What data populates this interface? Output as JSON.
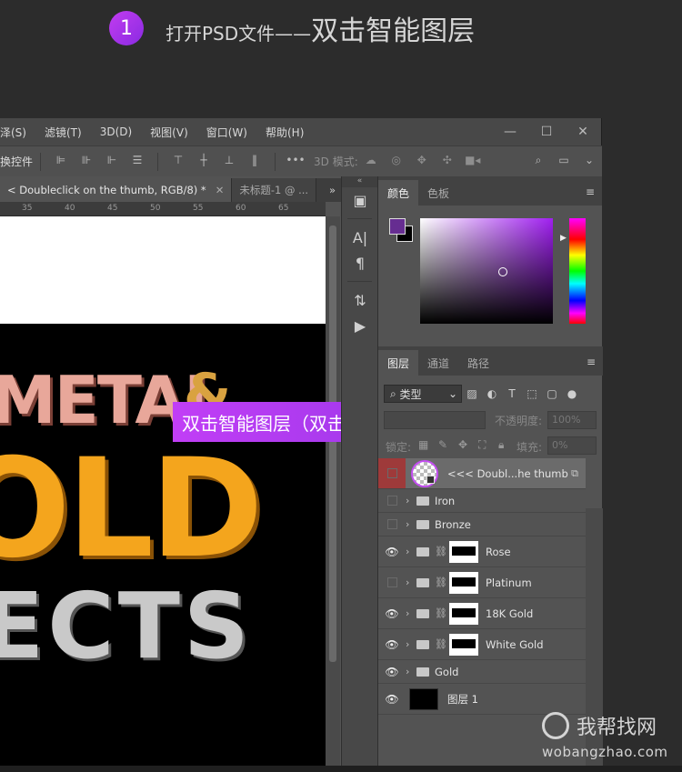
{
  "step": {
    "number": "1",
    "text_prefix": "打开PSD文件——",
    "text_main": "双击智能图层"
  },
  "menubar": {
    "items": [
      "泽(S)",
      "滤镜(T)",
      "3D(D)",
      "视图(V)",
      "窗口(W)",
      "帮助(H)"
    ],
    "window_controls": [
      "—",
      "☐",
      "✕"
    ]
  },
  "optionsbar": {
    "transform_label": "换控件",
    "three_d_mode_label": "3D 模式:"
  },
  "tabs": {
    "active": "< Doubleclick on the thumb, RGB/8) *",
    "inactive": "未标题-1 @ ...",
    "more": "»"
  },
  "ruler": {
    "ticks": [
      "35",
      "40",
      "45",
      "50",
      "55",
      "60",
      "65"
    ]
  },
  "artwork": {
    "line1": "METAL",
    "amp": "&",
    "line2": "OLD",
    "line3": "ECTS"
  },
  "callout": {
    "text": "双击智能图层（双击圈内）"
  },
  "color_panel": {
    "tabs": [
      "颜色",
      "色板"
    ],
    "foreground": "#662d91",
    "background": "#000000"
  },
  "layers_panel": {
    "tabs": [
      "图层",
      "通道",
      "路径"
    ],
    "filter_label": "类型",
    "opacity_label": "不透明度:",
    "opacity_value": "100%",
    "lock_label": "锁定:",
    "fill_label": "填充:",
    "fill_value": "0%",
    "layers": [
      {
        "name": "<<< Doubl...he thumb",
        "visible": false,
        "selected": true,
        "kind": "smart"
      },
      {
        "name": "Iron",
        "visible": false,
        "kind": "folder"
      },
      {
        "name": "Bronze",
        "visible": false,
        "kind": "folder"
      },
      {
        "name": "Rose",
        "visible": true,
        "kind": "folder-mask"
      },
      {
        "name": "Platinum",
        "visible": false,
        "kind": "folder-mask"
      },
      {
        "name": "18K Gold",
        "visible": true,
        "kind": "folder-mask"
      },
      {
        "name": "White Gold",
        "visible": true,
        "kind": "folder-mask"
      },
      {
        "name": "Gold",
        "visible": true,
        "kind": "folder"
      },
      {
        "name": "图层 1",
        "visible": true,
        "kind": "fill"
      }
    ]
  },
  "watermark": {
    "cn": "我帮找网",
    "en": "wobangzhao.com"
  },
  "colors": {
    "accent": "#b03ef2",
    "selected_layer_eye": "#9e3a3a"
  }
}
